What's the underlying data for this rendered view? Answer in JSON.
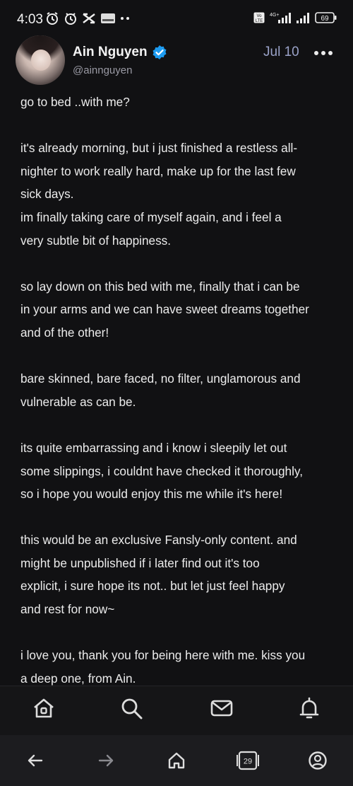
{
  "status_bar": {
    "time": "4:03",
    "network": "4G+",
    "volte": "Vo LTE",
    "battery": "69"
  },
  "post": {
    "author_name": "Ain Nguyen",
    "author_handle": "@ainnguyen",
    "date": "Jul 10",
    "paragraphs": [
      [
        "go to bed ..with me?"
      ],
      [
        "it's already morning, but i just finished a restless all-",
        "nighter to work really hard, make up for the last few",
        "sick days.",
        "im finally taking care of myself again, and i feel a",
        "very subtle bit of happiness."
      ],
      [
        "so lay down on this bed with me, finally that i can be",
        "in your arms and we can have sweet dreams together",
        "and of the other!"
      ],
      [
        "bare skinned, bare faced, no filter, unglamorous and",
        "vulnerable as can be."
      ],
      [
        "its quite embarrassing and i know i sleepily let out",
        "some slippings, i couldnt have checked it thoroughly,",
        "so i hope you would enjoy this me while it's here!"
      ],
      [
        "this would be an exclusive Fansly-only content. and",
        "might be unpublished if i later find out it's too",
        "explicit, i sure hope its not.. but let just feel happy",
        "and rest for now~"
      ],
      [
        "i love you, thank you for being here with me. kiss you",
        "a deep one, from Ain."
      ]
    ]
  },
  "bottom_nav": {
    "items": [
      "home-icon",
      "search-icon",
      "messages-icon",
      "notifications-icon"
    ]
  },
  "system_nav": {
    "tab_count": "29",
    "items": [
      "back-icon",
      "forward-icon",
      "home-icon",
      "tabs-icon",
      "account-icon"
    ]
  },
  "colors": {
    "background": "#111113",
    "text": "#ececec",
    "muted": "#9a9aa4",
    "date": "#9aa2c8",
    "verified": "#1d9bf0"
  }
}
